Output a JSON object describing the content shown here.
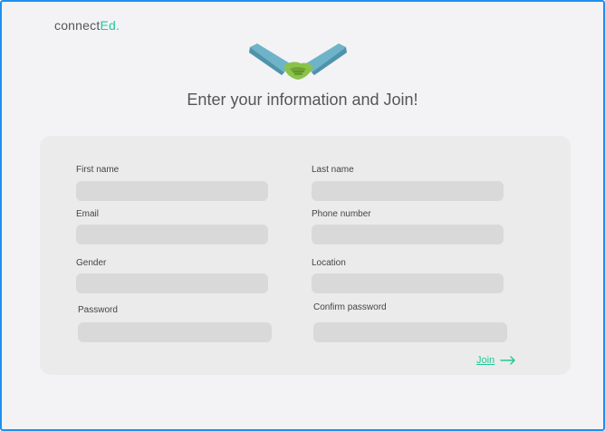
{
  "brand": {
    "name_prefix": "connect",
    "name_suffix": "Ed.",
    "accent_color": "#20c997"
  },
  "hero": {
    "icon": "handshake-icon"
  },
  "page": {
    "title": "Enter your information and Join!"
  },
  "form": {
    "first_name": {
      "label": "First name",
      "value": "",
      "placeholder": ""
    },
    "last_name": {
      "label": "Last name",
      "value": "",
      "placeholder": ""
    },
    "email": {
      "label": "Email",
      "value": "",
      "placeholder": ""
    },
    "phone": {
      "label": "Phone number",
      "value": "",
      "placeholder": ""
    },
    "gender": {
      "label": "Gender",
      "value": "",
      "placeholder": ""
    },
    "location": {
      "label": "Location",
      "value": "",
      "placeholder": ""
    },
    "password": {
      "label": "Password",
      "value": "",
      "placeholder": ""
    },
    "confirm_password": {
      "label": "Confirm password",
      "value": "",
      "placeholder": ""
    },
    "join_label": "Join",
    "join_icon": "arrow-right-icon"
  },
  "colors": {
    "frame_border": "#1e90f0",
    "background": "#f3f3f5",
    "card": "#ebebeb",
    "input": "#d9d9d9"
  }
}
